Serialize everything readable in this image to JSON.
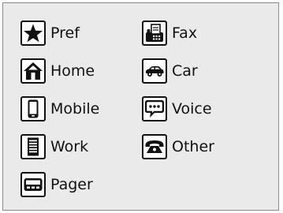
{
  "phone_types": [
    {
      "label": "Pref",
      "icon": "star-icon"
    },
    {
      "label": "Fax",
      "icon": "fax-icon"
    },
    {
      "label": "Home",
      "icon": "home-icon"
    },
    {
      "label": "Car",
      "icon": "car-icon"
    },
    {
      "label": "Mobile",
      "icon": "mobile-phone-icon"
    },
    {
      "label": "Voice",
      "icon": "speech-bubble-icon"
    },
    {
      "label": "Work",
      "icon": "office-building-icon"
    },
    {
      "label": "Other",
      "icon": "telephone-handset-icon"
    },
    {
      "label": "Pager",
      "icon": "pager-icon"
    }
  ]
}
